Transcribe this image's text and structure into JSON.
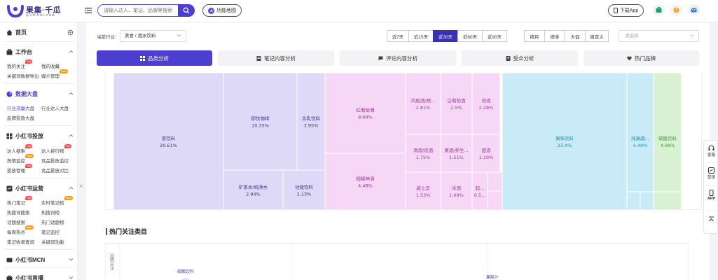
{
  "header": {
    "logo_cn": "果集·千瓜",
    "logo_en": "QIAN-GUA.COM",
    "search_placeholder": "请输入达人、笔记、品牌等搜索",
    "feature_map_label": "功能地图",
    "download_app_label": "下载App",
    "colors": {
      "brand": "#4b3fd1"
    }
  },
  "sidebar": {
    "home_label": "首页",
    "sections": [
      {
        "title": "工作台",
        "items": [
          "我的关注",
          "我的收藏",
          "关键词数据导出",
          "媒介管理"
        ]
      },
      {
        "title": "数据大盘",
        "items": [
          "行业流量大盘",
          "行业达人大盘",
          "品牌投放大盘"
        ]
      },
      {
        "title": "小红书投放",
        "items": [
          "达人搜索",
          "达人排行榜",
          "舆情监控",
          "竞品投放监控",
          "投放管理",
          "竞品投放对比"
        ]
      },
      {
        "title": "小红书运营",
        "items": [
          "热门笔记",
          "实时笔记榜",
          "热搜词搜索",
          "热搜词榜",
          "话题搜索",
          "热门话题榜",
          "每周热点",
          "笔记监控",
          "笔记收录查询",
          "关键词功能"
        ]
      },
      {
        "title": "小红书MCN",
        "items": []
      },
      {
        "title": "小红书直播",
        "items": []
      }
    ],
    "badges": {
      "hot": "Hot",
      "new": "New"
    },
    "collapse_glyph": "«"
  },
  "filters": {
    "industry_label": "当前行业:",
    "industry_value": "美食 / 酒水饮料",
    "ranges": [
      "近7天",
      "近15天",
      "近30天",
      "近60天",
      "近90天"
    ],
    "active_range": "近30天",
    "periods": [
      "按月",
      "按季",
      "大促",
      "自定义"
    ],
    "choose_placeholder": "请选择"
  },
  "tabs": [
    {
      "label": "品类分析",
      "icon": "grid-icon",
      "active": true
    },
    {
      "label": "笔记内容分析",
      "icon": "note-icon",
      "active": false
    },
    {
      "label": "评论内容分析",
      "icon": "comment-icon",
      "active": false
    },
    {
      "label": "受众分析",
      "icon": "audience-icon",
      "active": false
    },
    {
      "label": "热门品牌",
      "icon": "heart-icon",
      "active": false
    }
  ],
  "chart_data": [
    {
      "type": "treemap",
      "items": [
        {
          "name": "茶饮料",
          "value": "20.61%",
          "color": "#ded9f7"
        },
        {
          "name": "即饮咖啡",
          "value": "10.35%",
          "color": "#ded9f7"
        },
        {
          "name": "含乳饮料",
          "value": "3.95%",
          "color": "#ded9f7"
        },
        {
          "name": "矿泉水/纯净水",
          "value": "2.94%",
          "color": "#ded9f7"
        },
        {
          "name": "功能饮料",
          "value": "2.13%",
          "color": "#ded9f7"
        },
        {
          "name": "红葡萄酒",
          "value": "8.69%",
          "color": "#f6d7f6"
        },
        {
          "name": "精酿啤酒",
          "value": "4.48%",
          "color": "#f6d7f6"
        },
        {
          "name": "鸡尾酒/预...",
          "value": "2.81%",
          "color": "#f6d7f6"
        },
        {
          "name": "白葡萄酒",
          "value": "2.5%",
          "color": "#f6d7f6"
        },
        {
          "name": "烧酒",
          "value": "2.28%",
          "color": "#f6d7f6"
        },
        {
          "name": "清酒/烧酒",
          "value": "1.75%",
          "color": "#f6d7f6"
        },
        {
          "name": "黄酒/养生...",
          "value": "1.51%",
          "color": "#f6d7f6"
        },
        {
          "name": "甜酒",
          "value": "1.19%",
          "color": "#f6d7f6"
        },
        {
          "name": "威士忌",
          "value": "1.53%",
          "color": "#f6d7f6"
        },
        {
          "name": "米酒",
          "value": "1.09%",
          "color": "#f6d7f6"
        },
        {
          "name": "起...",
          "value": "0.5...",
          "color": "#f6d7f6"
        },
        {
          "name": "果味饮料",
          "value": "23.4%",
          "color": "#c9ebf7"
        },
        {
          "name": "纯果蔬...",
          "value": "4.48%",
          "color": "#c9ebf7"
        },
        {
          "name": "碳酸饮料",
          "value": "4.98%",
          "color": "#d8f2d3"
        }
      ]
    },
    {
      "type": "scatter",
      "title": "热门关注类目",
      "ylabel": "品牌关注",
      "points": [
        {
          "name": "碳酸饮料"
        },
        {
          "name": "果味汁"
        }
      ]
    }
  ],
  "float_toolbar": [
    "客服",
    "营销",
    "APP"
  ]
}
